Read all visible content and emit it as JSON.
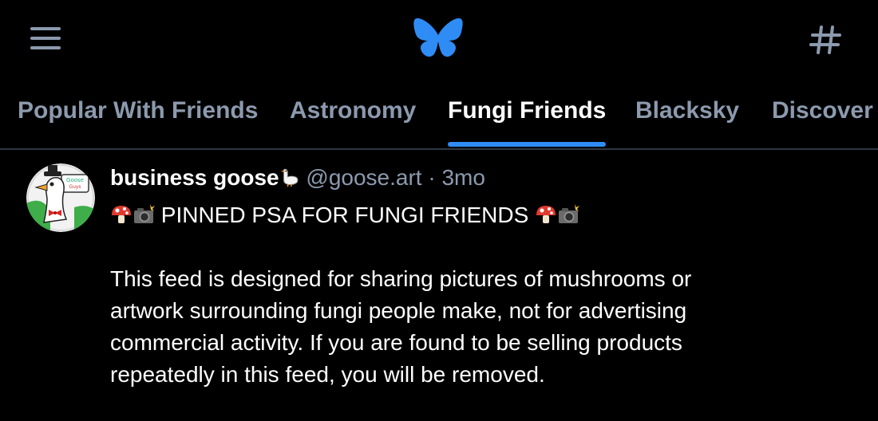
{
  "header": {
    "menu_icon": "hamburger-menu-icon",
    "logo_icon": "bluesky-butterfly-icon",
    "feeds_icon": "hashtag-icon",
    "brand_color": "#2f8cf5"
  },
  "tabs": [
    {
      "label": "Popular With Friends",
      "active": false
    },
    {
      "label": "Astronomy",
      "active": false
    },
    {
      "label": "Fungi Friends",
      "active": true
    },
    {
      "label": "Blacksky",
      "active": false
    },
    {
      "label": "Discover",
      "active": false
    }
  ],
  "post": {
    "author_name": "business goose",
    "author_emoji": "goose-emoji",
    "handle": "@goose.art",
    "separator": "·",
    "time": "3mo",
    "title_icons": [
      "mushroom-emoji",
      "camera-flash-emoji"
    ],
    "title": "PINNED PSA FOR FUNGI FRIENDS",
    "body_lines": [
      "This feed is designed for sharing pictures of mushrooms or",
      "artwork surrounding fungi people make, not for advertising",
      "commercial activity. If you are found to be selling products",
      "repeatedly in this feed, you will be removed."
    ]
  },
  "colors": {
    "background": "#000000",
    "text_primary": "#ffffff",
    "text_secondary": "#8c9aae",
    "divider": "#2e3742",
    "accent": "#2f8cf5"
  }
}
